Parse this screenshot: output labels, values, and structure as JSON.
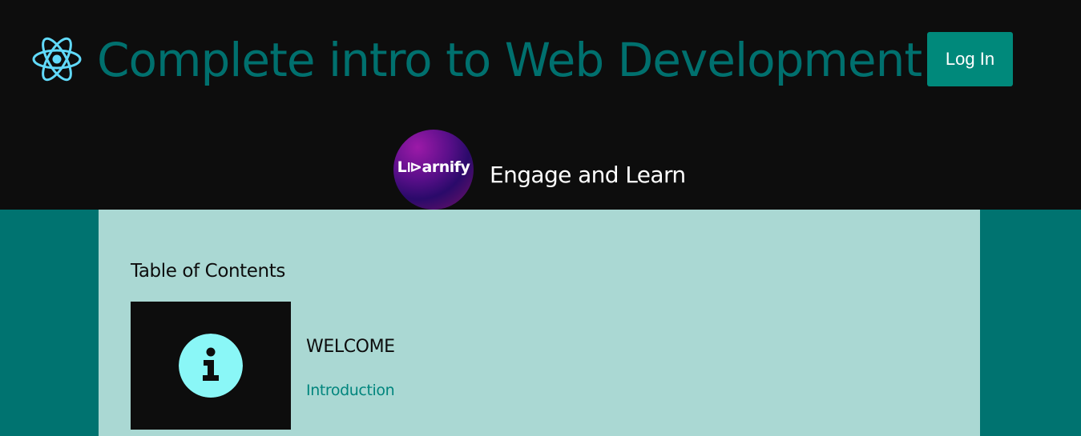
{
  "header": {
    "logo_icon": "react-atom-icon",
    "title": "Complete intro to Web Development",
    "login_label": "Log In",
    "brand_name": "L⧐arnify",
    "tagline": "Engage and Learn"
  },
  "toc": {
    "heading": "Table of Contents",
    "sections": [
      {
        "icon": "info-icon",
        "title": "WELCOME",
        "links": [
          "Introduction"
        ]
      }
    ]
  },
  "colors": {
    "page_background": "#007370",
    "header_background": "#0d0d0d",
    "panel_background": "#aad8d3",
    "title_teal": "#00706e",
    "button_teal": "#00897b",
    "link_teal": "#00857d",
    "react_blue": "#61dafb",
    "info_cyan": "#8af7f7",
    "white": "#ffffff"
  }
}
